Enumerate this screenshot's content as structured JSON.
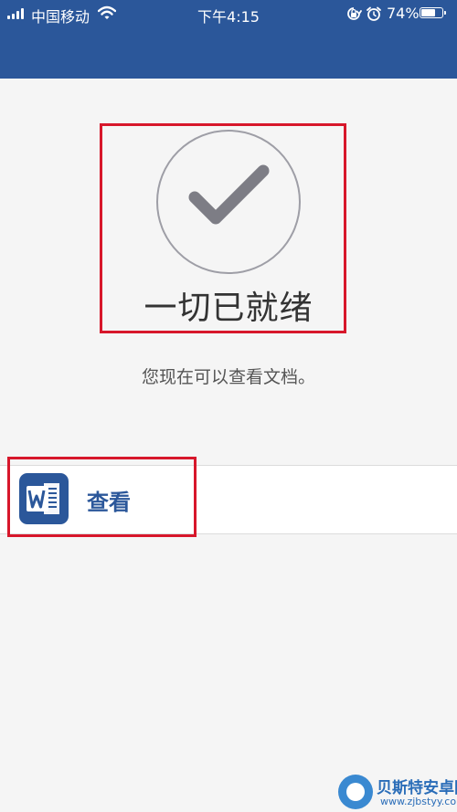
{
  "status_bar": {
    "carrier": "中国移动",
    "time": "下午4:15",
    "battery_percent": "74%",
    "battery_level": 0.74,
    "icons": [
      "signal-icon",
      "wifi-icon",
      "orientation-lock-icon",
      "alarm-icon",
      "battery-icon"
    ]
  },
  "colors": {
    "header": "#2b579a",
    "highlight_border": "#d7172b",
    "background": "#f5f5f5",
    "accent_text": "#2b579a"
  },
  "main": {
    "ready_title": "一切已就绪",
    "ready_subtitle": "您现在可以查看文档。",
    "status_icon": "checkmark-circle-icon"
  },
  "action": {
    "view_label": "查看",
    "icon": "word-document-icon"
  },
  "watermark": {
    "title": "贝斯特安卓网",
    "url": "www.zjbstyy.com"
  }
}
